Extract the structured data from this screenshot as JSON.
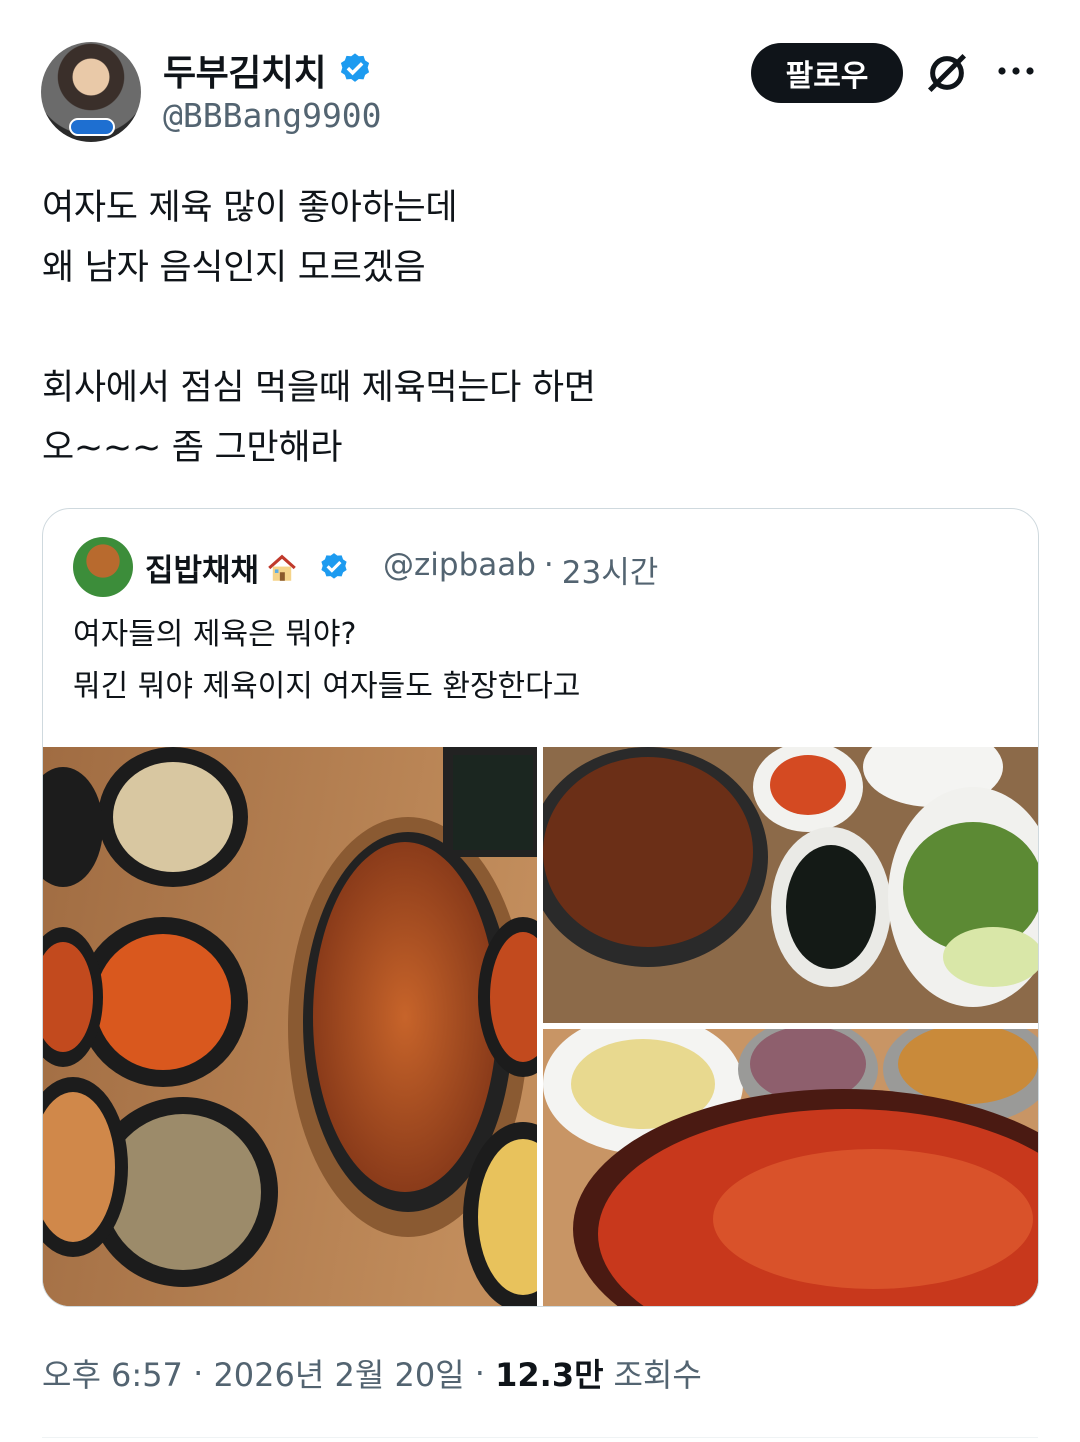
{
  "author": {
    "display_name": "두부김치치",
    "handle": "@BBBang9900",
    "verified": true,
    "avatar_icon": "profile-photo"
  },
  "actions": {
    "follow_label": "팔로우",
    "grok_icon": "grok-icon",
    "more_icon": "more-dots-icon"
  },
  "tweet": {
    "text": "여자도 제육 많이 좋아하는데\n왜 남자 음식인지 모르겠음\n\n회사에서 점심 먹을때 제육먹는다 하면\n오~~~ 좀 그만해라"
  },
  "quote": {
    "display_name": "집밥채채",
    "handle": "@zipbaab",
    "separator": "·",
    "time_ago": "23시간",
    "verified": true,
    "text": "여자들의 제육은 뭐야?\n뭐긴 뭐야 제육이지 여자들도 환장한다고",
    "photo_count": 3
  },
  "meta": {
    "time": "오후 6:57",
    "separator": " · ",
    "date": "2026년 2월 20일",
    "views_count": "12.3만",
    "views_label": "조회수"
  },
  "colors": {
    "text": "#0f1419",
    "secondary": "#536471",
    "verified": "#1d9bf0",
    "border": "#cfd9de"
  }
}
